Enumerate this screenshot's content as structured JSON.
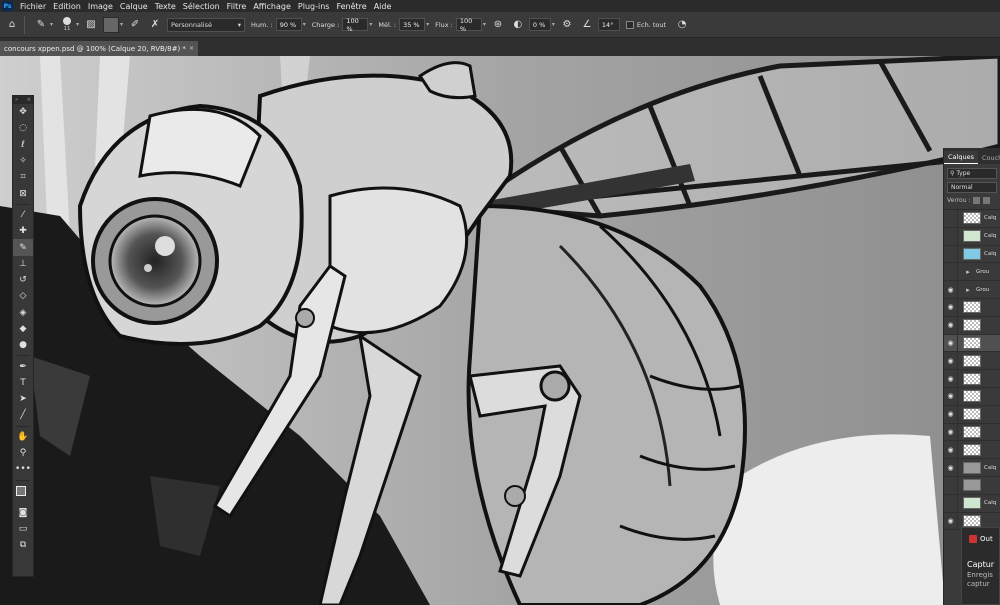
{
  "menubar": {
    "app_icon": "Ps",
    "items": [
      "Fichier",
      "Edition",
      "Image",
      "Calque",
      "Texte",
      "Sélection",
      "Filtre",
      "Affichage",
      "Plug-ins",
      "Fenêtre",
      "Aide"
    ]
  },
  "options": {
    "home_icon": "home-icon",
    "brush_size": "11",
    "preset": "Personnalisé",
    "hum_label": "Hum. :",
    "hum_value": "90 %",
    "charge_label": "Charge :",
    "charge_value": "100 %",
    "mel_label": "Mél. :",
    "mel_value": "35 %",
    "flux_label": "Flux :",
    "flux_value": "100 %",
    "smoothing_value": "0 %",
    "angle_value": "14°",
    "sample_all_label": "Ech. tout"
  },
  "tab": {
    "title": "concours xppen.psd @ 100% (Calque 20, RVB/8#) *",
    "close": "×"
  },
  "toolbar": {
    "collapse": "»",
    "close": "×",
    "tools": [
      {
        "name": "move-tool-icon",
        "glyph": "✥"
      },
      {
        "name": "marquee-tool-icon",
        "glyph": "◌"
      },
      {
        "name": "lasso-tool-icon",
        "glyph": "ℓ"
      },
      {
        "name": "magic-wand-tool-icon",
        "glyph": "✧"
      },
      {
        "name": "crop-tool-icon",
        "glyph": "⌗"
      },
      {
        "name": "frame-tool-icon",
        "glyph": "⊠"
      },
      {
        "name": "eyedropper-tool-icon",
        "glyph": "⁄"
      },
      {
        "name": "healing-brush-tool-icon",
        "glyph": "✚"
      },
      {
        "name": "mixer-brush-tool-icon",
        "glyph": "✎"
      },
      {
        "name": "clone-stamp-tool-icon",
        "glyph": "⊥"
      },
      {
        "name": "history-brush-tool-icon",
        "glyph": "↺"
      },
      {
        "name": "eraser-tool-icon",
        "glyph": "◇"
      },
      {
        "name": "paint-bucket-tool-icon",
        "glyph": "◈"
      },
      {
        "name": "blur-tool-icon",
        "glyph": "◆"
      },
      {
        "name": "dodge-tool-icon",
        "glyph": "●"
      },
      {
        "name": "pen-tool-icon",
        "glyph": "✒"
      },
      {
        "name": "type-tool-icon",
        "glyph": "T"
      },
      {
        "name": "path-selection-tool-icon",
        "glyph": "➤"
      },
      {
        "name": "line-tool-icon",
        "glyph": "╱"
      },
      {
        "name": "hand-tool-icon",
        "glyph": "✋"
      },
      {
        "name": "zoom-tool-icon",
        "glyph": "⚲"
      },
      {
        "name": "more-tools-icon",
        "glyph": "•••"
      }
    ],
    "extra": [
      {
        "name": "quick-mask-icon",
        "glyph": "◙"
      },
      {
        "name": "screen-mode-icon",
        "glyph": "▭"
      },
      {
        "name": "artboard-icon",
        "glyph": "⧉"
      }
    ]
  },
  "layers": {
    "tab_layers": "Calques",
    "tab_channels": "Couch",
    "search_placeholder": "Type",
    "blend_mode": "Normal",
    "lock_label": "Verrou :",
    "rows": [
      {
        "label": "Calq",
        "thumb": "checker",
        "visible": false
      },
      {
        "label": "Calq",
        "thumb": "green",
        "visible": false
      },
      {
        "label": "Calq",
        "thumb": "blue",
        "visible": false
      },
      {
        "label": "Grou",
        "thumb": "folder",
        "visible": false
      },
      {
        "label": "Grou",
        "thumb": "folder",
        "visible": true
      },
      {
        "label": "",
        "thumb": "checker",
        "visible": true
      },
      {
        "label": "",
        "thumb": "checker",
        "visible": true
      },
      {
        "label": "",
        "thumb": "checker",
        "visible": true,
        "selected": true
      },
      {
        "label": "",
        "thumb": "checker",
        "visible": true
      },
      {
        "label": "",
        "thumb": "checker",
        "visible": true
      },
      {
        "label": "",
        "thumb": "checker",
        "visible": true
      },
      {
        "label": "",
        "thumb": "checker",
        "visible": true
      },
      {
        "label": "",
        "thumb": "checker",
        "visible": true
      },
      {
        "label": "",
        "thumb": "checker",
        "visible": true
      },
      {
        "label": "Calq",
        "thumb": "grey",
        "visible": true
      },
      {
        "label": "",
        "thumb": "grey",
        "visible": false
      },
      {
        "label": "Calq",
        "thumb": "green",
        "visible": false
      },
      {
        "label": "",
        "thumb": "checker",
        "visible": true
      }
    ]
  },
  "notification": {
    "app": "Out",
    "title": "Captur",
    "body_line1": "Enregis",
    "body_line2": "captur"
  },
  "colors": {
    "menubar": "#2b2b2b",
    "options": "#3a3a3a",
    "canvas_bg": "#8f8f8f",
    "accent": "#31a8ff"
  }
}
